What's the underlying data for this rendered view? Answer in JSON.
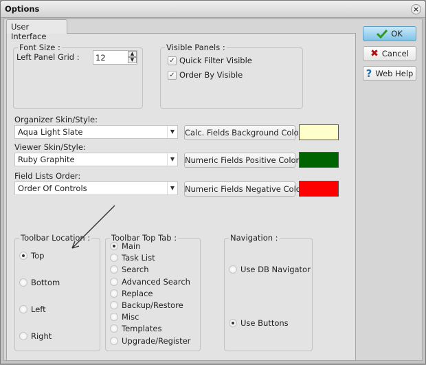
{
  "window": {
    "title": "Options",
    "close_icon": "close-icon"
  },
  "tabs": [
    {
      "label": "User Interface",
      "active": true
    }
  ],
  "font_size": {
    "legend": "Font Size :",
    "left_panel_grid_label": "Left Panel Grid :",
    "left_panel_grid_value": "12"
  },
  "visible_panels": {
    "legend": "Visible Panels :",
    "items": [
      {
        "label": "Quick Filter Visible",
        "checked": true
      },
      {
        "label": "Order By Visible",
        "checked": true
      }
    ]
  },
  "organizer_skin": {
    "label": "Organizer Skin/Style:",
    "value": "Aqua Light Slate"
  },
  "viewer_skin": {
    "label": "Viewer Skin/Style:",
    "value": "Ruby Graphite"
  },
  "field_lists_order": {
    "label": "Field Lists Order:",
    "value": "Order Of Controls"
  },
  "color_buttons": [
    {
      "label": "Calc. Fields Background Color",
      "color": "#ffffcc"
    },
    {
      "label": "Numeric Fields Positive Color",
      "color": "#006400"
    },
    {
      "label": "Numeric Fields Negative Color",
      "color": "#ff0000"
    }
  ],
  "toolbar_location": {
    "legend": "Toolbar Location :",
    "options": [
      "Top",
      "Bottom",
      "Left",
      "Right"
    ],
    "selected": "Top"
  },
  "toolbar_top_tab": {
    "legend": "Toolbar Top Tab :",
    "options": [
      "Main",
      "Task List",
      "Search",
      "Advanced Search",
      "Replace",
      "Backup/Restore",
      "Misc",
      "Templates",
      "Upgrade/Register"
    ],
    "selected": "Main"
  },
  "navigation": {
    "legend": "Navigation :",
    "options": [
      "Use DB Navigator",
      "Use Buttons"
    ],
    "selected": "Use Buttons"
  },
  "side_buttons": {
    "ok": "OK",
    "cancel": "Cancel",
    "help": "Web Help"
  },
  "colors": {
    "ok_check": "#2e9a1e",
    "cancel_x": "#b01010",
    "help_q": "#1f73b7"
  }
}
